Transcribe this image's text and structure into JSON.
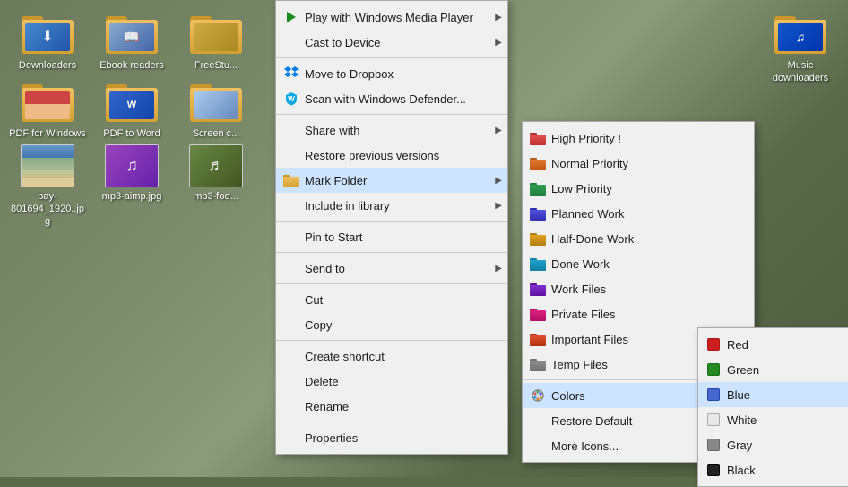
{
  "desktop": {
    "bg_color": "#5a7040",
    "icons": [
      {
        "id": "downloaders",
        "label": "Downloaders",
        "thumb": "downloader"
      },
      {
        "id": "ebook-readers",
        "label": "Ebook readers",
        "thumb": "ebook"
      },
      {
        "id": "freestudio",
        "label": "FreeStu...",
        "thumb": "freest"
      },
      {
        "id": "pdf-for-windows",
        "label": "PDF for Windows",
        "thumb": "pdf-win"
      },
      {
        "id": "pdf-to-word",
        "label": "PDF to Word",
        "thumb": "pdf-word"
      },
      {
        "id": "screen-capture",
        "label": "Screen c...",
        "thumb": "screenc"
      },
      {
        "id": "bay-image",
        "label": "bay-801694_1920..jpg",
        "thumb": "bay",
        "is_file": true
      },
      {
        "id": "mp3-aimp",
        "label": "mp3-aimp.jpg",
        "thumb": "mp3-aimp",
        "is_file": true
      },
      {
        "id": "mp3-foo",
        "label": "mp3-foo...",
        "thumb": "mp3-foo",
        "is_file": true
      }
    ],
    "music_icon": {
      "label": "Music downloaders",
      "thumb": "music"
    }
  },
  "main_context_menu": {
    "items": [
      {
        "id": "play",
        "label": "Play with Windows Media Player",
        "has_arrow": true
      },
      {
        "id": "cast",
        "label": "Cast to Device",
        "has_arrow": true
      },
      {
        "id": "sep1",
        "type": "separator"
      },
      {
        "id": "move-dropbox",
        "label": "Move to Dropbox",
        "has_icon": "dropbox"
      },
      {
        "id": "scan-defender",
        "label": "Scan with Windows Defender...",
        "has_icon": "defender"
      },
      {
        "id": "sep2",
        "type": "separator"
      },
      {
        "id": "share-with",
        "label": "Share with",
        "has_arrow": true
      },
      {
        "id": "restore",
        "label": "Restore previous versions"
      },
      {
        "id": "mark-folder",
        "label": "Mark Folder",
        "has_icon": "folder-color",
        "has_arrow": true,
        "highlighted": true
      },
      {
        "id": "include-library",
        "label": "Include in library",
        "has_arrow": true
      },
      {
        "id": "sep3",
        "type": "separator"
      },
      {
        "id": "pin-start",
        "label": "Pin to Start"
      },
      {
        "id": "sep4",
        "type": "separator"
      },
      {
        "id": "send-to",
        "label": "Send to",
        "has_arrow": true
      },
      {
        "id": "sep5",
        "type": "separator"
      },
      {
        "id": "cut",
        "label": "Cut"
      },
      {
        "id": "copy",
        "label": "Copy"
      },
      {
        "id": "sep6",
        "type": "separator"
      },
      {
        "id": "create-shortcut",
        "label": "Create shortcut"
      },
      {
        "id": "delete",
        "label": "Delete"
      },
      {
        "id": "rename",
        "label": "Rename"
      },
      {
        "id": "sep7",
        "type": "separator"
      },
      {
        "id": "properties",
        "label": "Properties"
      }
    ]
  },
  "mark_folder_submenu": {
    "items": [
      {
        "id": "high-priority",
        "label": "High Priority !",
        "color": "#e05050"
      },
      {
        "id": "normal-priority",
        "label": "Normal Priority",
        "color": "#e07830"
      },
      {
        "id": "low-priority",
        "label": "Low Priority",
        "color": "#30a050"
      },
      {
        "id": "planned-work",
        "label": "Planned Work",
        "color": "#5050e0"
      },
      {
        "id": "half-done",
        "label": "Half-Done Work",
        "color": "#e0a020"
      },
      {
        "id": "done-work",
        "label": "Done Work",
        "color": "#20a0d0"
      },
      {
        "id": "work-files",
        "label": "Work Files",
        "color": "#8030d0"
      },
      {
        "id": "private-files",
        "label": "Private Files",
        "color": "#e02080"
      },
      {
        "id": "important-files",
        "label": "Important Files",
        "color": "#e05030"
      },
      {
        "id": "temp-files",
        "label": "Temp Files",
        "color": "#909090"
      },
      {
        "id": "sep1",
        "type": "separator"
      },
      {
        "id": "colors",
        "label": "Colors",
        "has_icon": "palette",
        "has_arrow": true,
        "highlighted": true
      },
      {
        "id": "restore-default",
        "label": "Restore Default"
      },
      {
        "id": "more-icons",
        "label": "More Icons..."
      }
    ]
  },
  "colors_submenu": {
    "items": [
      {
        "id": "red",
        "label": "Red",
        "color": "#cc2020"
      },
      {
        "id": "green",
        "label": "Green",
        "color": "#228b22"
      },
      {
        "id": "blue",
        "label": "Blue",
        "color": "#4466cc",
        "highlighted": true
      },
      {
        "id": "white",
        "label": "White",
        "color": "#e8e8e8"
      },
      {
        "id": "gray",
        "label": "Gray",
        "color": "#888888"
      },
      {
        "id": "black",
        "label": "Black",
        "color": "#222222"
      }
    ]
  }
}
